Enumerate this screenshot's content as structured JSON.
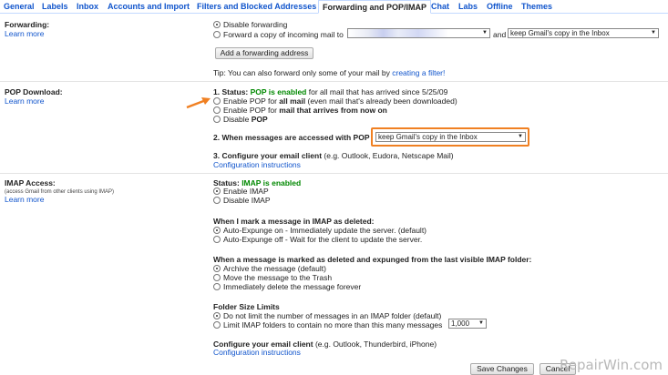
{
  "tabs": [
    "General",
    "Labels",
    "Inbox",
    "Accounts and Import",
    "Filters and Blocked Addresses",
    "Forwarding and POP/IMAP",
    "Chat",
    "Labs",
    "Offline",
    "Themes"
  ],
  "learn_more": "Learn more",
  "forwarding": {
    "label": "Forwarding:",
    "disable": "Disable forwarding",
    "forward_copy": "Forward a copy of incoming mail to",
    "and": "and",
    "action_select": "keep Gmail's copy in the Inbox",
    "add_button": "Add a forwarding address",
    "tip": "Tip: You can also forward only some of your mail by",
    "tip_link": "creating a filter!"
  },
  "pop": {
    "label": "POP Download:",
    "status_prefix": "1. Status:",
    "status_value": "POP is enabled",
    "status_suffix": "for all mail that has arrived since 5/25/09",
    "opt1_a": "Enable POP for",
    "opt1_b": "all mail",
    "opt1_c": "(even mail that's already been downloaded)",
    "opt2_a": "Enable POP for",
    "opt2_b": "mail that arrives from now on",
    "opt3": "Disable",
    "opt3_b": "POP",
    "when_accessed": "2. When messages are accessed with POP",
    "access_select": "keep Gmail's copy in the Inbox",
    "configure": "3. Configure your email client",
    "configure_hint": "(e.g. Outlook, Eudora, Netscape Mail)",
    "config_link": "Configuration instructions"
  },
  "imap": {
    "label": "IMAP Access:",
    "sub": "(access Gmail from other clients using IMAP)",
    "status_prefix": "Status:",
    "status_value": "IMAP is enabled",
    "enable": "Enable IMAP",
    "disable": "Disable IMAP",
    "deleted_heading": "When I mark a message in IMAP as deleted:",
    "expunge_on": "Auto-Expunge on - Immediately update the server. (default)",
    "expunge_off": "Auto-Expunge off - Wait for the client to update the server.",
    "expunged_heading": "When a message is marked as deleted and expunged from the last visible IMAP folder:",
    "archive": "Archive the message (default)",
    "trash": "Move the message to the Trash",
    "delete_forever": "Immediately delete the message forever",
    "folder_heading": "Folder Size Limits",
    "no_limit": "Do not limit the number of messages in an IMAP folder (default)",
    "limit": "Limit IMAP folders to contain no more than this many messages",
    "limit_select": "1,000",
    "configure": "Configure your email client",
    "configure_hint": "(e.g. Outlook, Thunderbird, iPhone)",
    "config_link": "Configuration instructions"
  },
  "footer": {
    "save": "Save Changes",
    "cancel": "Cancel"
  },
  "watermark": "RepairWin.com",
  "colors": {
    "link": "#1155cc",
    "status_green": "#008800",
    "highlight": "#f08022"
  }
}
